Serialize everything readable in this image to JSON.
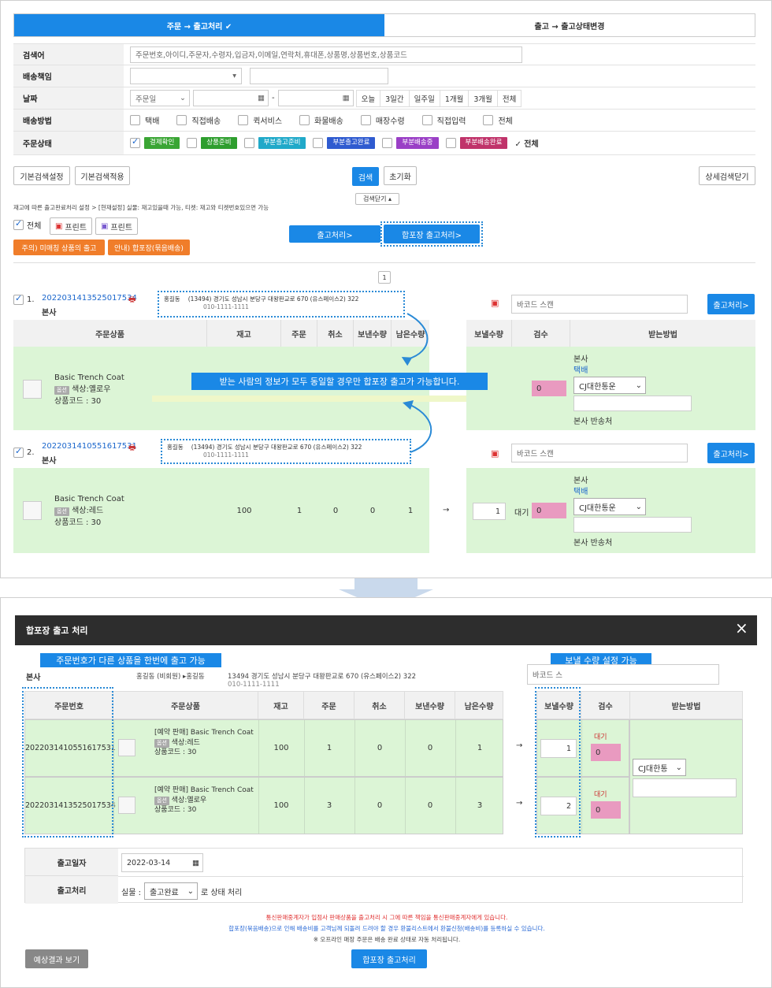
{
  "top_tabs": [
    "주문 → 출고처리 ✔",
    "출고 → 출고상태변경"
  ],
  "search": {
    "keyword_label": "검색어",
    "keyword_placeholder": "주문번호,아이디,주문자,수령자,입금자,이메일,연락처,휴대폰,상품명,상품번호,상품코드",
    "resp_label": "배송책임",
    "date_label": "날짜",
    "date_type": "주문일",
    "date_quick": [
      "오늘",
      "3일간",
      "일주일",
      "1개월",
      "3개월",
      "전체"
    ],
    "ship_label": "배송방법",
    "ship_options": [
      "택배",
      "직접배송",
      "퀵서비스",
      "화물배송",
      "매장수령",
      "직접입력",
      "전체"
    ],
    "status_label": "주문상태",
    "status_tags": [
      "결제확인",
      "상품준비",
      "부분출고준비",
      "부분출고완료",
      "부분배송중",
      "부분배송완료"
    ],
    "status_all": "✓ 전체",
    "status_colors": [
      "#3aa534",
      "#2e9e2e",
      "#20a9c9",
      "#2f5bd0",
      "#9a3fc6",
      "#c0336a"
    ]
  },
  "buttons": {
    "basic_set": "기본검색설정",
    "basic_apply": "기본검색적용",
    "search": "검색",
    "reset": "초기화",
    "detail_close": "상세검색닫기",
    "search_close": "검색닫기 ▴"
  },
  "stock_note": "재고에 따른 출고완료처리 설정 > [현재설정] 실물: 재고있을때 가능, 티켓: 재고와 티켓번호있으면 가능",
  "all_label": "전체",
  "print1": "프린트",
  "print2": "프린트",
  "mismatch_btn": "주의) 미매칭 상품의 출고",
  "guide_btn": "안내) 합포장(묶음배송)",
  "ship_btn": "출고처리>",
  "combine_btn": "합포장 출고처리>",
  "page": "1",
  "order_headers": [
    "주문상품",
    "재고",
    "주문",
    "취소",
    "보낸수량",
    "남은수량"
  ],
  "right_headers": [
    "보낼수량",
    "검수",
    "받는방법"
  ],
  "orders": [
    {
      "no": "1.",
      "id": "2022031413525017534",
      "store": "본사",
      "name": "홍길동",
      "addr": "(13494) 경기도 성남시 분당구 대왕판교로 670 (유스페이스2) 322",
      "phone": "010-1111-1111",
      "barcode": "바코드 스캔",
      "btn": "출고처리>",
      "product": "Basic Trench Coat",
      "opt_tag": "옵션",
      "opt": "색상:옐로우",
      "code": "상품코드 : 30",
      "stock": "",
      "ord": "",
      "cancel": "",
      "sent": "",
      "left": "",
      "send_qty": "",
      "check": "0",
      "recv_store": "본사",
      "recv_method": "택배",
      "courier": "CJ대한통운",
      "return": "본사 반송처"
    },
    {
      "no": "2.",
      "id": "2022031410551617531",
      "store": "본사",
      "name": "홍길동",
      "addr": "(13494) 경기도 성남시 분당구 대왕판교로 670 (유스페이스2) 322",
      "phone": "010-1111-1111",
      "barcode": "바코드 스캔",
      "btn": "출고처리>",
      "product": "Basic Trench Coat",
      "opt_tag": "옵션",
      "opt": "색상:레드",
      "code": "상품코드 : 30",
      "stock": "100",
      "ord": "1",
      "cancel": "0",
      "sent": "0",
      "left": "1",
      "send_qty": "1",
      "wait": "대기",
      "check": "0",
      "recv_store": "본사",
      "recv_method": "택배",
      "courier": "CJ대한통운",
      "return": "본사 반송처"
    }
  ],
  "banner": "받는 사람의 정보가 모두 동일할 경우만 합포장 출고가 가능합니다.",
  "modal": {
    "title": "합포장 출고 처리",
    "callout_left": "주문번호가 다른 상품을 한번에 출고 가능",
    "callout_right": "보낼 수량 설정 가능",
    "store": "본사",
    "who": "홍길동 (비회원) ▸홍길동",
    "addr": "13494 경기도 성남시 분당구 대왕판교로 670 (유스페이스2) 322",
    "phone": "010-1111-1111",
    "barcode": "바코드 스",
    "headers": [
      "주문번호",
      "주문상품",
      "재고",
      "주문",
      "취소",
      "보낸수량",
      "남은수량"
    ],
    "right_headers": [
      "보낼수량",
      "검수",
      "받는방법"
    ],
    "rows": [
      {
        "order": "2022031410551617531",
        "product": "[예약 판매] Basic Trench Coat",
        "opt_tag": "옵션",
        "opt": "색상:레드",
        "code": "상품코드 : 30",
        "stock": "100",
        "ord": "1",
        "cancel": "0",
        "sent": "0",
        "left": "1",
        "send": "1",
        "wait": "대기",
        "check": "0"
      },
      {
        "order": "2022031413525017534",
        "product": "[예약 판매] Basic Trench Coat",
        "opt_tag": "옵션",
        "opt": "색상:옐로우",
        "code": "상품코드 : 30",
        "stock": "100",
        "ord": "3",
        "cancel": "0",
        "sent": "0",
        "left": "3",
        "send": "2",
        "wait": "대기",
        "check": "0"
      }
    ],
    "courier": "CJ대한통",
    "date_label": "출고일자",
    "date": "2022-03-14",
    "proc_label": "출고처리",
    "proc_prefix": "실물 :",
    "proc_value": "출고완료",
    "proc_suffix": "로 상태 처리",
    "note1": "통신판매중계자가 입점사 판매상품을 출고처리 시 그에 따른 책임을 통신판매중계자에게 있습니다.",
    "note2": "합포장(묶음배송)으로 인해 배송비를 고객님께 되돌려 드려야 할 경우 환불리스트에서 환불신청(배송비)를 등록하실 수 있습니다.",
    "note3": "※ 오프라인 매장 주문은 배송 완료 상태로 자동 처리됩니다.",
    "preview_btn": "예상결과 보기",
    "submit_btn": "합포장 출고처리"
  }
}
